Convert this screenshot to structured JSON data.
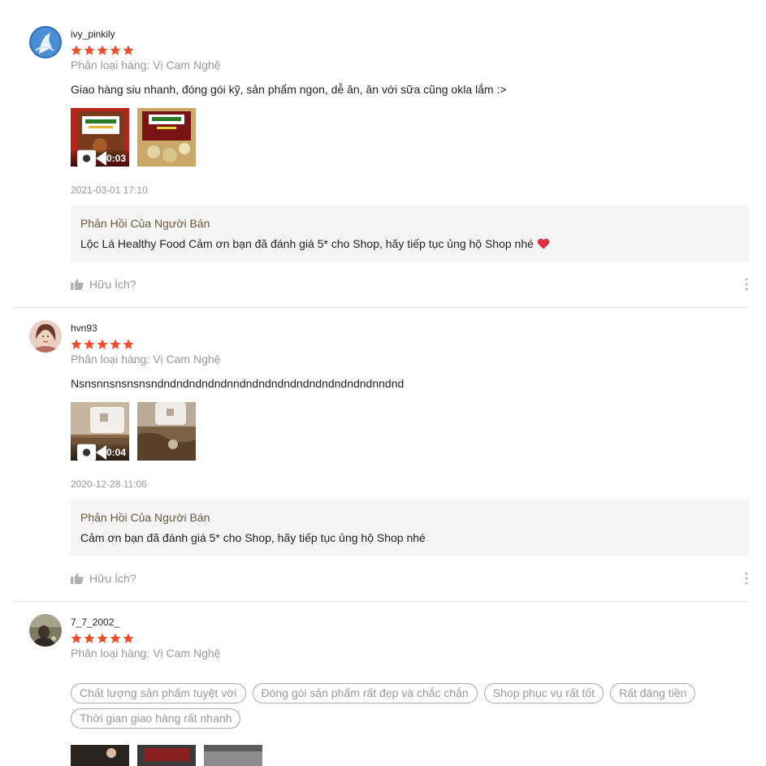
{
  "colors": {
    "star": "#ee4d2d",
    "reply_title": "#6b5740",
    "muted": "#999999"
  },
  "reviews": [
    {
      "username": "ivy_pinkily",
      "avatar_icon": "swan-avatar",
      "rating": 5,
      "variation": "Phân loại hàng: Vị Cam Nghệ",
      "comment": "Giao hàng siu nhanh, đóng gói kỹ, sản phẩm ngon, dễ ăn, ăn với sữa cũng okla lắm :>",
      "video_duration": "0:03",
      "time": "2021-03-01 17:10",
      "reply_title": "Phản Hồi Của Người Bán",
      "reply_text": "Lộc Lá Healthy Food Cảm ơn bạn đã đánh giá 5* cho Shop, hãy tiếp tục ủng hộ Shop nhé",
      "helpful": "Hữu Ích?"
    },
    {
      "username": "hvn93",
      "avatar_icon": "person-avatar",
      "rating": 5,
      "variation": "Phân loại hàng: Vị Cam Nghệ",
      "comment": "Nsnsnnsnsnsnsndndndndndndnndndndndndndndndndndndnndnd",
      "video_duration": "0:04",
      "time": "2020-12-28 11:06",
      "reply_title": "Phản Hồi Của Người Bán",
      "reply_text": "Cảm ơn bạn đã đánh giá 5* cho Shop, hãy tiếp tục ủng hộ Shop nhé",
      "helpful": "Hữu Ích?"
    },
    {
      "username": "7_7_2002_",
      "avatar_icon": "photo-avatar",
      "rating": 5,
      "variation": "Phân loại hàng: Vị Cam Nghệ",
      "tags": [
        "Chất lượng sản phẩm tuyệt vời",
        "Đóng gói sản phẩm rất đẹp và chắc chắn",
        "Shop phục vụ rất tốt",
        "Rất đáng tiền",
        "Thời gian giao hàng rất nhanh"
      ]
    }
  ]
}
